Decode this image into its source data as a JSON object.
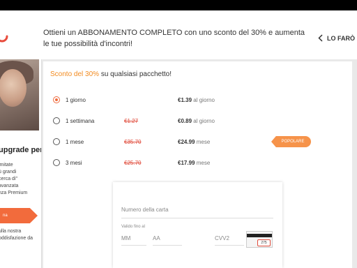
{
  "header": {
    "headline": "Ottieni un ABBONAMENTO COMPLETO con uno sconto del 30% e aumenta le tue possibilità d'incontri!",
    "later_label": "LO FARÒ"
  },
  "sidebar": {
    "upgrade_title": "upgrade per:",
    "benefits": [
      "imitate",
      "ù grandi",
      "cerca di\"",
      "avanzata",
      "nza Premium"
    ],
    "button_label": "na",
    "guarantee": [
      "ulla nostra",
      "oddisfazione da"
    ]
  },
  "panel": {
    "discount_accent": "Sconto del 30%",
    "discount_rest": " su qualsiasi pacchetto!",
    "popular_badge": "POPOLARE",
    "plans": [
      {
        "label": "1 giorno",
        "old_price": "",
        "price": "€1.39",
        "unit": "al giorno",
        "selected": true
      },
      {
        "label": "1 settimana",
        "old_price": "€1.27",
        "price": "€0.89",
        "unit": "al giorno",
        "selected": false
      },
      {
        "label": "1 mese",
        "old_price": "€35.70",
        "price": "€24.99",
        "unit": "mese",
        "selected": false
      },
      {
        "label": "3 mesi",
        "old_price": "€25.70",
        "price": "€17.99",
        "unit": "mese",
        "selected": false
      }
    ]
  },
  "payment": {
    "card_number_placeholder": "Numero della carta",
    "valid_until_label": "Valido fino al",
    "month_placeholder": "MM",
    "year_placeholder": "AA",
    "cvv_placeholder": "CVV2",
    "cvv_example": "275"
  },
  "colors": {
    "accent": "#f28a1e",
    "brand": "#f26b3c",
    "strike": "#e04a3a",
    "selected_radio": "#f06a3c"
  }
}
